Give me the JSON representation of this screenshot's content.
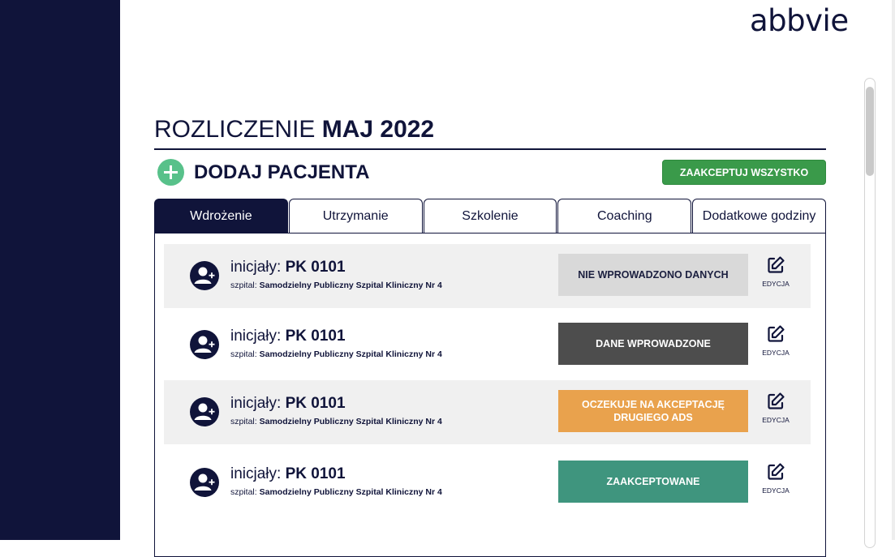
{
  "brand": {
    "logo_text": "abbvie"
  },
  "header": {
    "title_prefix": "ROZLICZENIE",
    "title_period": "MAJ 2022",
    "add_patient_label": "DODAJ PACJENTA",
    "accept_all_label": "ZAAKCEPTUJ WSZYSTKO"
  },
  "tabs": [
    {
      "label": "Wdrożenie",
      "active": true
    },
    {
      "label": "Utrzymanie",
      "active": false
    },
    {
      "label": "Szkolenie",
      "active": false
    },
    {
      "label": "Coaching",
      "active": false
    },
    {
      "label": "Dodatkowe godziny",
      "active": false
    }
  ],
  "patients": [
    {
      "initials_label": "inicjały:",
      "initials": "PK 0101",
      "hospital_label": "szpital:",
      "hospital": "Samodzielny Publiczny Szpital Kliniczny Nr 4",
      "status": "NIE WPROWADZONO DANYCH",
      "status_bg": "#d9d9d9",
      "status_fg": "#1b1f3f",
      "edit_label": "EDYCJA"
    },
    {
      "initials_label": "inicjały:",
      "initials": "PK 0101",
      "hospital_label": "szpital:",
      "hospital": "Samodzielny Publiczny Szpital Kliniczny Nr 4",
      "status": "DANE WPROWADZONE",
      "status_bg": "#4d4d4d",
      "status_fg": "#ffffff",
      "edit_label": "EDYCJA"
    },
    {
      "initials_label": "inicjały:",
      "initials": "PK 0101",
      "hospital_label": "szpital:",
      "hospital": "Samodzielny Publiczny Szpital Kliniczny Nr 4",
      "status": "OCZEKUJE NA AKCEPTACJĘ DRUGIEGO ADS",
      "status_bg": "#e9a24d",
      "status_fg": "#ffffff",
      "edit_label": "EDYCJA"
    },
    {
      "initials_label": "inicjały:",
      "initials": "PK 0101",
      "hospital_label": "szpital:",
      "hospital": "Samodzielny Publiczny Szpital Kliniczny Nr 4",
      "status": "ZAAKCEPTOWANE",
      "status_bg": "#3f957e",
      "status_fg": "#ffffff",
      "edit_label": "EDYCJA"
    }
  ],
  "colors": {
    "navy": "#10143a",
    "accept_green": "#3a9a4a",
    "add_green": "#58c18a"
  },
  "icons": {
    "add": "plus-circle-icon",
    "avatar": "user-add-icon",
    "edit": "edit-icon"
  }
}
